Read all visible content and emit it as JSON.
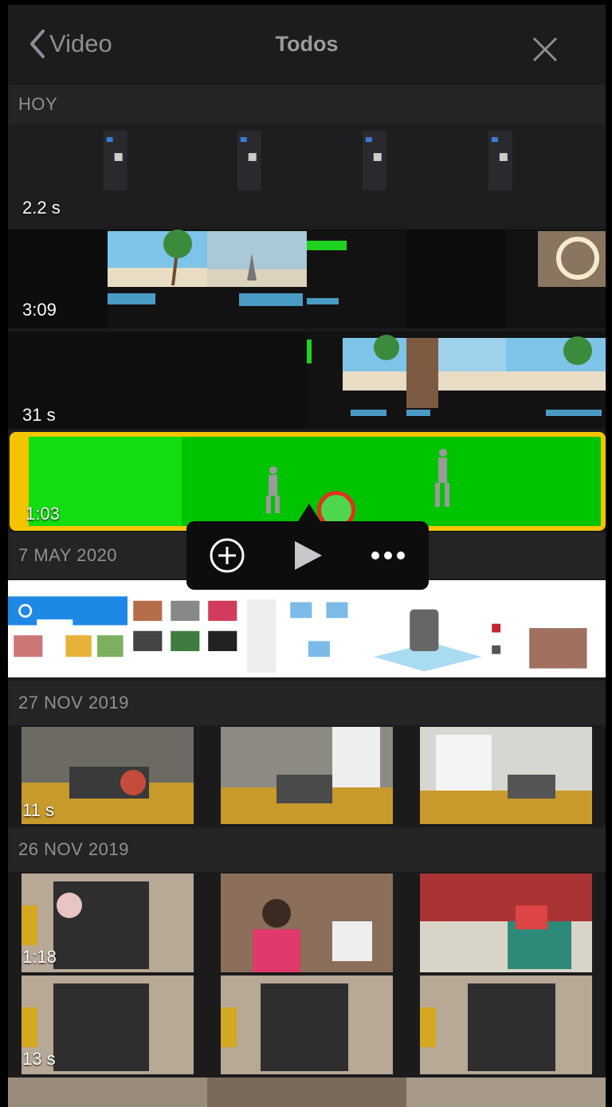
{
  "navbar": {
    "back_label": "Video",
    "title": "Todos",
    "back_icon": "chevron-left-icon",
    "close_icon": "close-icon"
  },
  "sections": [
    {
      "header": "HOY"
    },
    {
      "header": "7 MAY 2020"
    },
    {
      "header": "27 NOV 2019"
    },
    {
      "header": "26 NOV 2019"
    }
  ],
  "clips": [
    {
      "duration": "2.2 s"
    },
    {
      "duration": "3:09"
    },
    {
      "duration": "31 s"
    },
    {
      "duration": "1:03"
    },
    {
      "duration": "11 s"
    },
    {
      "duration": "1:18"
    },
    {
      "duration": "13 s"
    }
  ],
  "popup": {
    "add_icon": "plus-circle-icon",
    "play_icon": "play-icon",
    "more_icon": "ellipsis-icon"
  },
  "colors": {
    "selection_border": "#f4c400",
    "green_screen": "#11dd11",
    "touch_indicator": "#e0331f"
  }
}
